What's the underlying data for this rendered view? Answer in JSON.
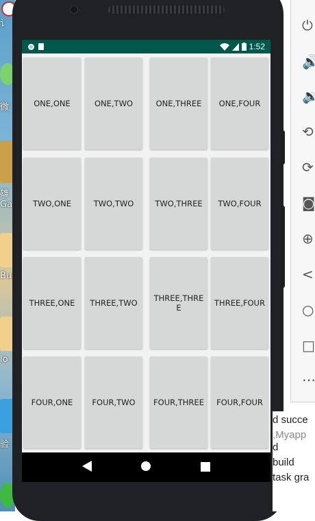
{
  "status_bar": {
    "time": "1:52"
  },
  "grid": [
    [
      "ONE,ONE",
      "ONE,TWO",
      "ONE,THREE",
      "ONE,FOUR"
    ],
    [
      "TWO,ONE",
      "TWO,TWO",
      "TWO,THREE",
      "TWO,FOUR"
    ],
    [
      "THREE,ONE",
      "THREE,TWO",
      "THREE,THREE",
      "THREE,FOUR"
    ],
    [
      "FOUR,ONE",
      "FOUR,TWO",
      "FOUR,THREE",
      "FOUR,FOUR"
    ]
  ],
  "desktop": {
    "labels": [
      "讠",
      "微",
      "雄",
      "Ga",
      "Bu",
      "lo",
      "验"
    ]
  },
  "console": {
    "lines": [
      "d succe",
      ",Myapp",
      "d",
      " build",
      "task gra"
    ]
  },
  "nav": {
    "back": "back-icon",
    "home": "home-icon",
    "recents": "recents-icon"
  },
  "emulator_tools": [
    "power-icon",
    "volume-up-icon",
    "volume-down-icon",
    "rotate-left-icon",
    "rotate-right-icon",
    "camera-icon",
    "zoom-icon",
    "back-icon",
    "home-icon",
    "overview-icon",
    "more-icon"
  ],
  "colors": {
    "status_bar": "#00574b",
    "cell": "#d6d7d7",
    "nav_bar": "#000000"
  }
}
